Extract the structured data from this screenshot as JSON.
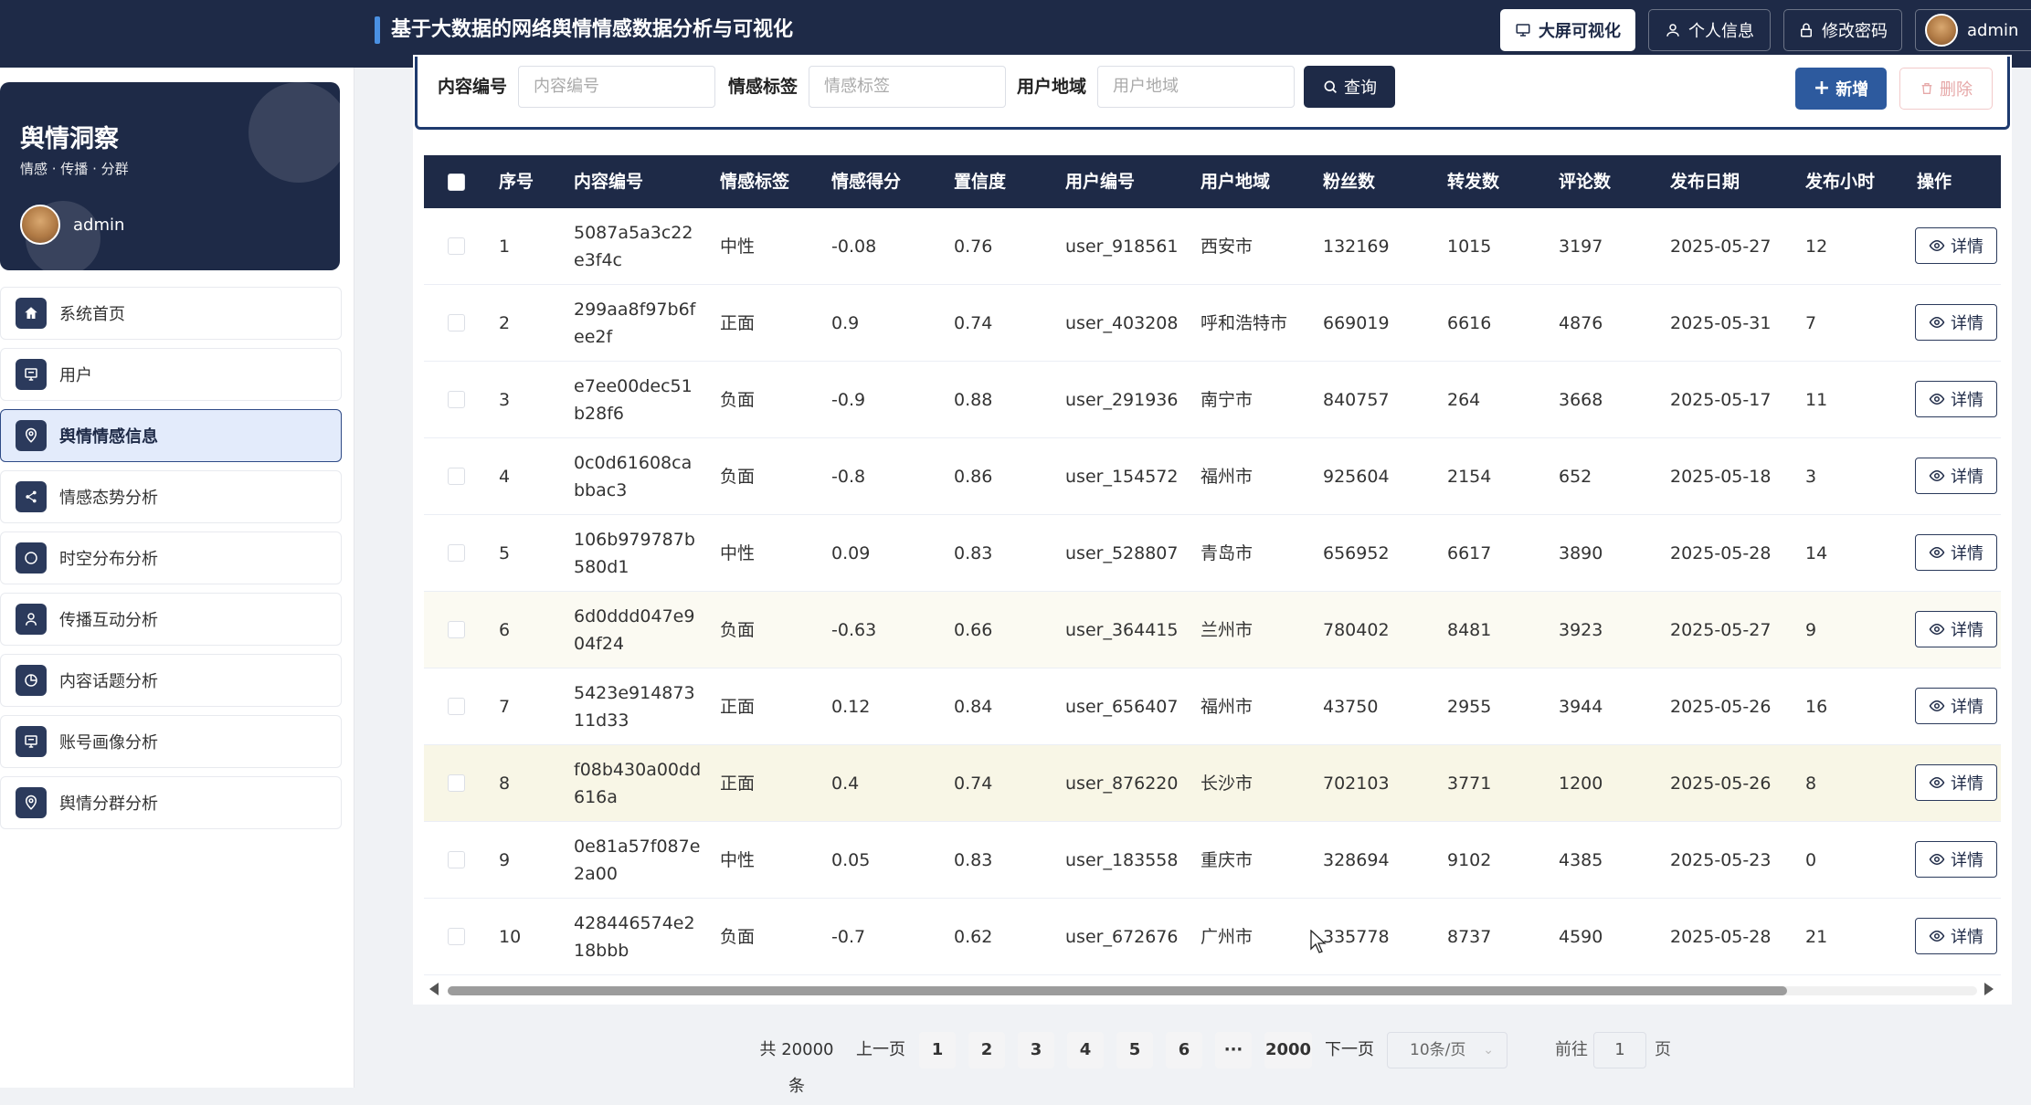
{
  "header": {
    "title": "基于大数据的网络舆情情感数据分析与可视化",
    "btn_bigscreen": "大屏可视化",
    "btn_profile": "个人信息",
    "btn_password": "修改密码",
    "username": "admin"
  },
  "brand": {
    "name": "舆情洞察",
    "subtitle": "情感 · 传播 · 分群",
    "username": "admin"
  },
  "menu": [
    {
      "label": "系统首页",
      "icon": "home-icon"
    },
    {
      "label": "用户",
      "icon": "monitor-icon"
    },
    {
      "label": "舆情情感信息",
      "icon": "location-icon",
      "active": true
    },
    {
      "label": "情感态势分析",
      "icon": "share-icon"
    },
    {
      "label": "时空分布分析",
      "icon": "chat-icon"
    },
    {
      "label": "传播互动分析",
      "icon": "user-icon"
    },
    {
      "label": "内容话题分析",
      "icon": "pie-icon"
    },
    {
      "label": "账号画像分析",
      "icon": "monitor-icon"
    },
    {
      "label": "舆情分群分析",
      "icon": "location-icon"
    }
  ],
  "search": {
    "content_id_label": "内容编号",
    "content_id_placeholder": "内容编号",
    "sentiment_label": "情感标签",
    "sentiment_placeholder": "情感标签",
    "region_label": "用户地域",
    "region_placeholder": "用户地域",
    "query_button": "查询",
    "add_button": "新增",
    "delete_button": "删除"
  },
  "table": {
    "columns": [
      "序号",
      "内容编号",
      "情感标签",
      "情感得分",
      "置信度",
      "用户编号",
      "用户地域",
      "粉丝数",
      "转发数",
      "评论数",
      "发布日期",
      "发布小时",
      "操作"
    ],
    "detail_label": "详情",
    "rows": [
      [
        "1",
        "5087a5a3c22e3f4c",
        "中性",
        "-0.08",
        "0.76",
        "user_918561",
        "西安市",
        "132169",
        "1015",
        "3197",
        "2025-05-27",
        "12"
      ],
      [
        "2",
        "299aa8f97b6fee2f",
        "正面",
        "0.9",
        "0.74",
        "user_403208",
        "呼和浩特市",
        "669019",
        "6616",
        "4876",
        "2025-05-31",
        "7"
      ],
      [
        "3",
        "e7ee00dec51b28f6",
        "负面",
        "-0.9",
        "0.88",
        "user_291936",
        "南宁市",
        "840757",
        "264",
        "3668",
        "2025-05-17",
        "11"
      ],
      [
        "4",
        "0c0d61608cabbac3",
        "负面",
        "-0.8",
        "0.86",
        "user_154572",
        "福州市",
        "925604",
        "2154",
        "652",
        "2025-05-18",
        "3"
      ],
      [
        "5",
        "106b979787b580d1",
        "中性",
        "0.09",
        "0.83",
        "user_528807",
        "青岛市",
        "656952",
        "6617",
        "3890",
        "2025-05-28",
        "14"
      ],
      [
        "6",
        "6d0ddd047e904f24",
        "负面",
        "-0.63",
        "0.66",
        "user_364415",
        "兰州市",
        "780402",
        "8481",
        "3923",
        "2025-05-27",
        "9"
      ],
      [
        "7",
        "5423e91487311d33",
        "正面",
        "0.12",
        "0.84",
        "user_656407",
        "福州市",
        "43750",
        "2955",
        "3944",
        "2025-05-26",
        "16"
      ],
      [
        "8",
        "f08b430a00dd616a",
        "正面",
        "0.4",
        "0.74",
        "user_876220",
        "长沙市",
        "702103",
        "3771",
        "1200",
        "2025-05-26",
        "8"
      ],
      [
        "9",
        "0e81a57f087e2a00",
        "中性",
        "0.05",
        "0.83",
        "user_183558",
        "重庆市",
        "328694",
        "9102",
        "4385",
        "2025-05-23",
        "0"
      ],
      [
        "10",
        "428446574e218bbb",
        "负面",
        "-0.7",
        "0.62",
        "user_672676",
        "广州市",
        "335778",
        "8737",
        "4590",
        "2025-05-28",
        "21"
      ]
    ]
  },
  "pagination": {
    "total": "共 20000 条",
    "prev": "上一页",
    "pages": [
      "1",
      "2",
      "3",
      "4",
      "5",
      "6"
    ],
    "ellipsis": "···",
    "last": "2000",
    "next": "下一页",
    "page_size": "10条/页",
    "goto_label": "前往",
    "goto_value": "1",
    "page_unit": "页"
  }
}
